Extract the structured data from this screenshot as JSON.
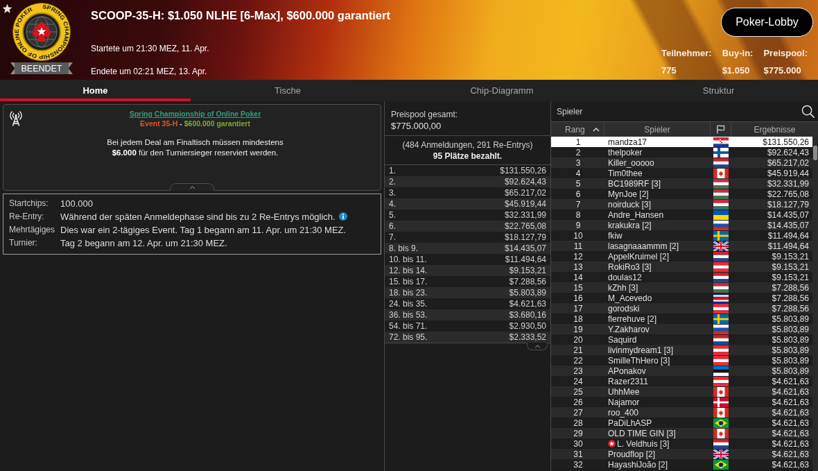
{
  "header": {
    "logo_text": "SPRING CHAMPIONSHIP OF ONLINE POKER",
    "status": "BEENDET",
    "title": "SCOOP-35-H: $1.050 NLHE [6-Max], $600.000 garantiert",
    "started": "Startete um 21:30 MEZ, 11. Apr.",
    "ended": "Endete um 02:21 MEZ, 13. Apr.",
    "lobby_button": "Poker-Lobby",
    "stats": [
      {
        "label": "Teilnehmer:",
        "value": "775"
      },
      {
        "label": "Buy-in:",
        "value": "$1.050"
      },
      {
        "label": "Preispool:",
        "value": "$775.000"
      }
    ]
  },
  "tabs": [
    {
      "label": "Home",
      "selected": true
    },
    {
      "label": "Tische",
      "selected": false
    },
    {
      "label": "Chip-Diagramm",
      "selected": false
    },
    {
      "label": "Struktur",
      "selected": false
    }
  ],
  "info_box": {
    "series_link": "Spring Championship of Online Poker",
    "event": "Event 35-H",
    "separator": "-",
    "guarantee": "$600.000 garantiert",
    "notice_lines": [
      "Bei jedem Deal am Finaltisch müssen mindestens",
      "**$6.000** für den Turniersieger reserviert werden."
    ]
  },
  "details": [
    {
      "label": "Startchips:",
      "lines": [
        "100.000"
      ],
      "info": false
    },
    {
      "label": "Re-Entry:",
      "lines": [
        "Während der späten Anmeldephase sind bis zu 2 Re-Entrys möglich."
      ],
      "info": true
    },
    {
      "label": "Mehrtägiges Turnier:",
      "lines": [
        "Dies war ein 2-tägiges Event. Tag 1 begann am 11. Apr. um 21:30 MEZ.",
        "Tag 2 begann am 12. Apr. um 21:30 MEZ."
      ],
      "info": false
    }
  ],
  "prize_pool": {
    "label": "Preispool gesamt:",
    "total": "$775.000,00",
    "entries": "(484 Anmeldungen, 291 Re-Entrys)",
    "paid": "95 Plätze bezahlt.",
    "payouts": [
      {
        "place": "1.",
        "amount": "$131.550,26"
      },
      {
        "place": "2.",
        "amount": "$92.624,43"
      },
      {
        "place": "3.",
        "amount": "$65.217,02"
      },
      {
        "place": "4.",
        "amount": "$45.919,44"
      },
      {
        "place": "5.",
        "amount": "$32.331,99"
      },
      {
        "place": "6.",
        "amount": "$22.765,08"
      },
      {
        "place": "7.",
        "amount": "$18.127,79"
      },
      {
        "place": "8. bis 9.",
        "amount": "$14.435,07"
      },
      {
        "place": "10. bis 11.",
        "amount": "$11.494,64"
      },
      {
        "place": "12. bis 14.",
        "amount": "$9.153,21"
      },
      {
        "place": "15. bis 17.",
        "amount": "$7.288,56"
      },
      {
        "place": "18. bis 23.",
        "amount": "$5.803,89"
      },
      {
        "place": "24. bis 35.",
        "amount": "$4.621,63"
      },
      {
        "place": "36. bis 53.",
        "amount": "$3.680,16"
      },
      {
        "place": "54. bis 71.",
        "amount": "$2.930,50"
      },
      {
        "place": "72. bis 95.",
        "amount": "$2.333,52"
      }
    ]
  },
  "players": {
    "search": {
      "placeholder": "Spieler"
    },
    "columns": [
      {
        "kind": "text",
        "label": "Rang",
        "sorted": true
      },
      {
        "kind": "text",
        "label": "Spieler",
        "sorted": false
      },
      {
        "kind": "flag",
        "sorted": false
      },
      {
        "kind": "text",
        "label": "Ergebnisse",
        "sorted": false
      }
    ],
    "rows": [
      {
        "rank": "1",
        "name": "mandza17",
        "flag": {
          "kind": "croatia"
        },
        "result": "$131.550,26",
        "selected": true,
        "pro": false
      },
      {
        "rank": "2",
        "name": "thelpoker",
        "flag": {
          "kind": "finland"
        },
        "result": "$92.624,43",
        "selected": false,
        "pro": false
      },
      {
        "rank": "3",
        "name": "Killer_ooooo",
        "flag": {
          "kind": "netherlands"
        },
        "result": "$65.217,02",
        "selected": false,
        "pro": false
      },
      {
        "rank": "4",
        "name": "Tim0thee",
        "flag": {
          "kind": "canada"
        },
        "result": "$45.919,44",
        "selected": false,
        "pro": false
      },
      {
        "rank": "5",
        "name": "BC1989RF [3]",
        "flag": {
          "kind": "hungary"
        },
        "result": "$32.331,99",
        "selected": false,
        "pro": false
      },
      {
        "rank": "6",
        "name": "MynJoe [2]",
        "flag": {
          "kind": "hungary"
        },
        "result": "$22.765,08",
        "selected": false,
        "pro": false
      },
      {
        "rank": "7",
        "name": "noirduck [3]",
        "flag": {
          "kind": "hungary"
        },
        "result": "$18.127,79",
        "selected": false,
        "pro": false
      },
      {
        "rank": "8",
        "name": "Andre_Hansen",
        "flag": {
          "kind": "ukraine"
        },
        "result": "$14.435,07",
        "selected": false,
        "pro": false
      },
      {
        "rank": "9",
        "name": "krakukra [2]",
        "flag": {
          "kind": "russia"
        },
        "result": "$14.435,07",
        "selected": false,
        "pro": false
      },
      {
        "rank": "10",
        "name": "fkiw",
        "flag": {
          "kind": "sweden"
        },
        "result": "$11.494,64",
        "selected": false,
        "pro": false
      },
      {
        "rank": "11",
        "name": "lasagnaaammm [2]",
        "flag": {
          "kind": "uk"
        },
        "result": "$11.494,64",
        "selected": false,
        "pro": false
      },
      {
        "rank": "12",
        "name": "AppelKruimel [2]",
        "flag": {
          "kind": "netherlands"
        },
        "result": "$9.153,21",
        "selected": false,
        "pro": false
      },
      {
        "rank": "13",
        "name": "RokiRo3 [3]",
        "flag": {
          "kind": "austria"
        },
        "result": "$9.153,21",
        "selected": false,
        "pro": false
      },
      {
        "rank": "14",
        "name": "doulas12",
        "flag": {
          "kind": "netherlands"
        },
        "result": "$9.153,21",
        "selected": false,
        "pro": false
      },
      {
        "rank": "15",
        "name": "kZhh [3]",
        "flag": {
          "kind": "hungary"
        },
        "result": "$7.288,56",
        "selected": false,
        "pro": false
      },
      {
        "rank": "16",
        "name": "M_Acevedo",
        "flag": {
          "kind": "costarica"
        },
        "result": "$7.288,56",
        "selected": false,
        "pro": false
      },
      {
        "rank": "17",
        "name": "gorodski",
        "flag": {
          "kind": "austria"
        },
        "result": "$7.288,56",
        "selected": false,
        "pro": false
      },
      {
        "rank": "18",
        "name": "flerrehuve [2]",
        "flag": {
          "kind": "sweden"
        },
        "result": "$5.803,89",
        "selected": false,
        "pro": false
      },
      {
        "rank": "19",
        "name": "Y.Zakharov",
        "flag": {
          "kind": "russia"
        },
        "result": "$5.803,89",
        "selected": false,
        "pro": false
      },
      {
        "rank": "20",
        "name": "Saquird",
        "flag": {
          "kind": "netherlands"
        },
        "result": "$5.803,89",
        "selected": false,
        "pro": false
      },
      {
        "rank": "21",
        "name": "livinmydream1 [3]",
        "flag": {
          "kind": "austria"
        },
        "result": "$5.803,89",
        "selected": false,
        "pro": false
      },
      {
        "rank": "22",
        "name": "SmilleThHero [3]",
        "flag": {
          "kind": "austria"
        },
        "result": "$5.803,89",
        "selected": false,
        "pro": false
      },
      {
        "rank": "23",
        "name": "APonakov",
        "flag": {
          "kind": "estonia"
        },
        "result": "$5.803,89",
        "selected": false,
        "pro": false
      },
      {
        "rank": "24",
        "name": "Razer2311",
        "flag": {
          "kind": "austria"
        },
        "result": "$4.621,63",
        "selected": false,
        "pro": false
      },
      {
        "rank": "25",
        "name": "UhhMee",
        "flag": {
          "kind": "canada"
        },
        "result": "$4.621,63",
        "selected": false,
        "pro": false
      },
      {
        "rank": "26",
        "name": "Najamor",
        "flag": {
          "kind": "denmark"
        },
        "result": "$4.621,63",
        "selected": false,
        "pro": false
      },
      {
        "rank": "27",
        "name": "roo_400",
        "flag": {
          "kind": "canada"
        },
        "result": "$4.621,63",
        "selected": false,
        "pro": false
      },
      {
        "rank": "28",
        "name": "PaDiLhASP",
        "flag": {
          "kind": "brazil"
        },
        "result": "$4.621,63",
        "selected": false,
        "pro": false
      },
      {
        "rank": "29",
        "name": "OLD TIME GIN [3]",
        "flag": {
          "kind": "canada"
        },
        "result": "$4.621,63",
        "selected": false,
        "pro": false
      },
      {
        "rank": "30",
        "name": "L. Veldhuis [3]",
        "flag": {
          "kind": "netherlands"
        },
        "result": "$4.621,63",
        "selected": false,
        "pro": true
      },
      {
        "rank": "31",
        "name": "Proudflop [2]",
        "flag": {
          "kind": "uk"
        },
        "result": "$4.621,63",
        "selected": false,
        "pro": false
      },
      {
        "rank": "32",
        "name": "HayashiJoão [2]",
        "flag": {
          "kind": "brazil"
        },
        "result": "$4.621,63",
        "selected": false,
        "pro": false
      }
    ]
  }
}
